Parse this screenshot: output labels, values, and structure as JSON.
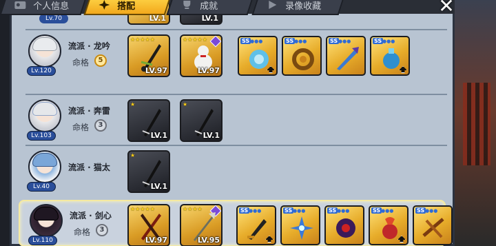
{
  "tabs": [
    {
      "label": "个人信息",
      "icon": "profile-icon",
      "active": false
    },
    {
      "label": "搭配",
      "icon": "shuriken-icon",
      "active": true
    },
    {
      "label": "成就",
      "icon": "trophy-icon",
      "active": false
    },
    {
      "label": "录像收藏",
      "icon": "play-icon",
      "active": false
    }
  ],
  "close_icon": "close-icon",
  "top_fragment": {
    "level": "Lv.70",
    "cards": [
      {
        "level": "LV.1",
        "kind": "gold"
      },
      {
        "level": "LV.1",
        "kind": "dark"
      }
    ]
  },
  "rows": [
    {
      "level": "Lv.120",
      "style": "流派 · 龙吟",
      "fate_label": "命格",
      "fate": "5",
      "fate_tier": "gold",
      "selected": false,
      "cards": [
        {
          "level": "LV.97",
          "kind": "gold",
          "stars": 5
        },
        {
          "level": "LV.97",
          "kind": "gold",
          "stars": 5
        }
      ],
      "items": [
        {
          "grade": "SS",
          "color": "#3a9ad9"
        },
        {
          "grade": "SS",
          "color": "#b5781e"
        },
        {
          "grade": "SS",
          "color": "#3b7ad0"
        },
        {
          "grade": "SS",
          "color": "#2f8fcf"
        }
      ]
    },
    {
      "level": "Lv.103",
      "style": "流派 · 奔雷",
      "fate_label": "命格",
      "fate": "3",
      "fate_tier": "silver",
      "selected": false,
      "cards": [
        {
          "level": "LV.1",
          "kind": "dark",
          "stars": 1
        },
        {
          "level": "LV.1",
          "kind": "dark",
          "stars": 1
        }
      ],
      "items": []
    },
    {
      "level": "Lv.40",
      "style": "流派 · 猫太",
      "fate_label": "",
      "fate": "",
      "fate_tier": "none",
      "selected": false,
      "cards": [
        {
          "level": "LV.1",
          "kind": "dark",
          "stars": 1
        }
      ],
      "items": []
    },
    {
      "level": "Lv.110",
      "style": "流派 · 剑心",
      "fate_label": "命格",
      "fate": "3",
      "fate_tier": "silver",
      "selected": true,
      "cards": [
        {
          "level": "LV.97",
          "kind": "gold",
          "stars": 5
        },
        {
          "level": "LV.95",
          "kind": "gold",
          "stars": 4
        }
      ],
      "items": [
        {
          "grade": "SS",
          "color": "#333"
        },
        {
          "grade": "SS",
          "color": "#3a7ad8"
        },
        {
          "grade": "SS",
          "color": "#3a1a5a"
        },
        {
          "grade": "SS",
          "color": "#c0282a"
        },
        {
          "grade": "SS",
          "color": "#a0561a"
        }
      ]
    }
  ]
}
